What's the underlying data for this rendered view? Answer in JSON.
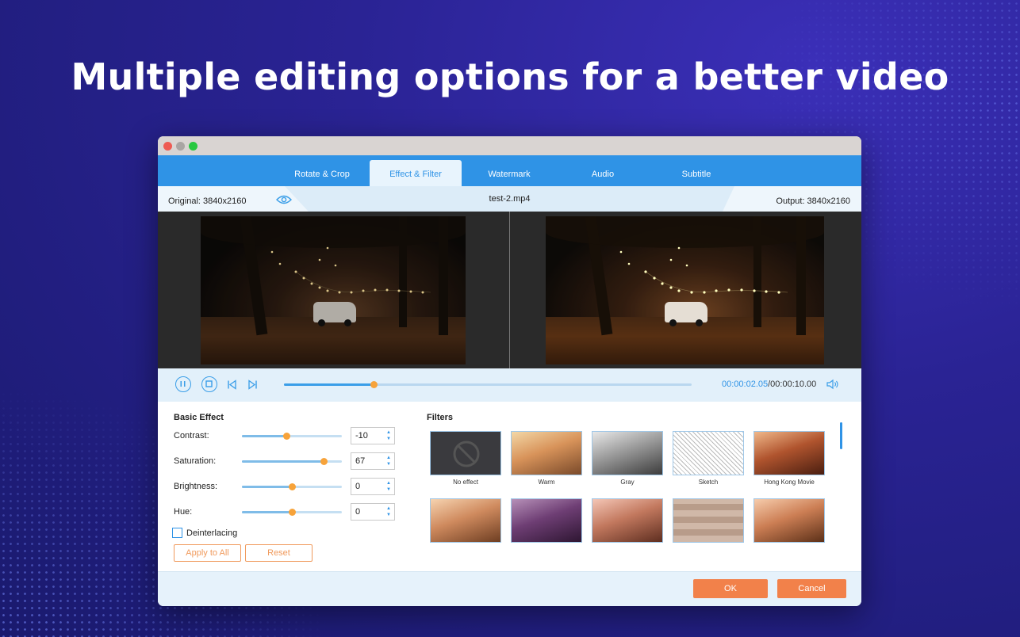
{
  "headline": "Multiple editing options for a better video",
  "tabs": [
    {
      "label": "Rotate & Crop",
      "active": false
    },
    {
      "label": "Effect & Filter",
      "active": true
    },
    {
      "label": "Watermark",
      "active": false
    },
    {
      "label": "Audio",
      "active": false
    },
    {
      "label": "Subtitle",
      "active": false
    }
  ],
  "info": {
    "original": "Original: 3840x2160",
    "filename": "test-2.mp4",
    "output": "Output: 3840x2160"
  },
  "playback": {
    "current_time": "00:00:02.05",
    "total_time": "/00:00:10.00",
    "progress_fraction": 0.22
  },
  "basic_effect": {
    "title": "Basic Effect",
    "rows": [
      {
        "label": "Contrast:",
        "value": "-10",
        "fraction": 0.45
      },
      {
        "label": "Saturation:",
        "value": "67",
        "fraction": 0.82
      },
      {
        "label": "Brightness:",
        "value": "0",
        "fraction": 0.5
      },
      {
        "label": "Hue:",
        "value": "0",
        "fraction": 0.5
      }
    ],
    "deinterlacing_label": "Deinterlacing",
    "deinterlacing_checked": false,
    "apply_all_label": "Apply to All",
    "reset_label": "Reset"
  },
  "filters": {
    "title": "Filters",
    "items": [
      {
        "label": "No effect",
        "style": "none"
      },
      {
        "label": "Warm",
        "style": "warm"
      },
      {
        "label": "Gray",
        "style": "gray"
      },
      {
        "label": "Sketch",
        "style": "sketch"
      },
      {
        "label": "Hong Kong Movie",
        "style": "hk"
      },
      {
        "label": "",
        "style": "warm2"
      },
      {
        "label": "",
        "style": "purple"
      },
      {
        "label": "",
        "style": "rose"
      },
      {
        "label": "",
        "style": "pixel"
      },
      {
        "label": "",
        "style": "warm3"
      }
    ]
  },
  "footer": {
    "ok_label": "OK",
    "cancel_label": "Cancel"
  },
  "colors": {
    "accent": "#2f93e6",
    "orange": "#f2814a",
    "knob": "#f7a33a"
  }
}
